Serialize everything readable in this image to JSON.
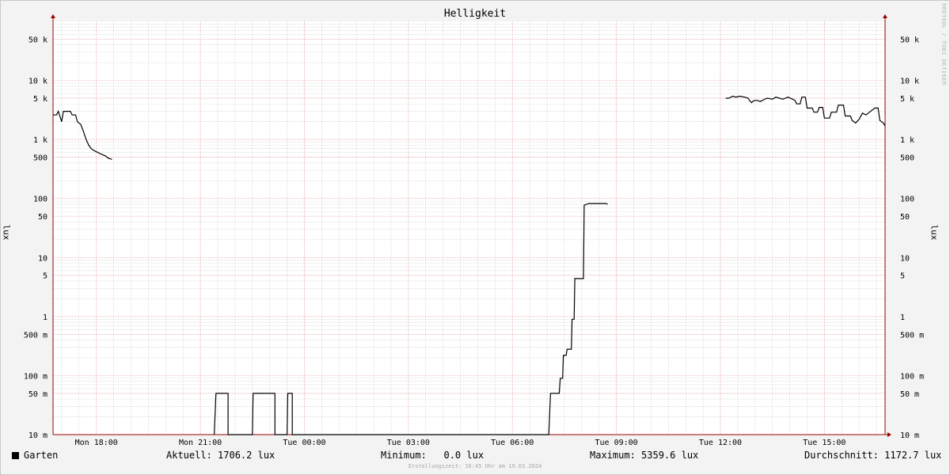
{
  "chart_data": {
    "type": "line",
    "title": "Helligkeit",
    "ylabel": "lux",
    "yscale": "log",
    "ylim": [
      0.01,
      100000
    ],
    "y_ticks": [
      {
        "value": 50000,
        "label": "50 k"
      },
      {
        "value": 10000,
        "label": "10 k"
      },
      {
        "value": 5000,
        "label": "5 k"
      },
      {
        "value": 1000,
        "label": "1 k"
      },
      {
        "value": 500,
        "label": "500"
      },
      {
        "value": 100,
        "label": "100"
      },
      {
        "value": 50,
        "label": "50"
      },
      {
        "value": 10,
        "label": "10"
      },
      {
        "value": 5,
        "label": "5"
      },
      {
        "value": 1,
        "label": "1"
      },
      {
        "value": 0.5,
        "label": "500 m"
      },
      {
        "value": 0.1,
        "label": "100 m"
      },
      {
        "value": 0.05,
        "label": "50 m"
      },
      {
        "value": 0.01,
        "label": "10 m"
      }
    ],
    "x_ticks": [
      "Mon 18:00",
      "Mon 21:00",
      "Tue 00:00",
      "Tue 03:00",
      "Tue 06:00",
      "Tue 09:00",
      "Tue 12:00",
      "Tue 15:00"
    ],
    "x_unit": "hours relative to Mon 18:00",
    "xlim": [
      -1.25,
      22.75
    ],
    "grid": true,
    "series": [
      {
        "name": "Garten",
        "color": "#000000",
        "segments": [
          [
            [
              -1.25,
              2600
            ],
            [
              -1.15,
              2600
            ],
            [
              -1.1,
              3000
            ],
            [
              -1.0,
              2000
            ],
            [
              -0.95,
              3000
            ],
            [
              -0.75,
              3000
            ],
            [
              -0.7,
              2600
            ],
            [
              -0.6,
              2600
            ],
            [
              -0.55,
              2000
            ],
            [
              -0.45,
              1800
            ],
            [
              -0.38,
              1400
            ],
            [
              -0.32,
              1100
            ],
            [
              -0.28,
              950
            ],
            [
              -0.22,
              800
            ],
            [
              -0.15,
              700
            ],
            [
              -0.05,
              640
            ],
            [
              0.05,
              600
            ],
            [
              0.15,
              560
            ],
            [
              0.25,
              530
            ],
            [
              0.35,
              480
            ],
            [
              0.4,
              470
            ],
            [
              0.45,
              460
            ]
          ],
          [
            [
              3.4,
              0.01
            ],
            [
              3.45,
              0.05
            ],
            [
              3.8,
              0.05
            ],
            [
              3.8,
              0.01
            ],
            [
              4.5,
              0.01
            ],
            [
              4.52,
              0.05
            ],
            [
              5.15,
              0.05
            ],
            [
              5.15,
              0.01
            ],
            [
              5.5,
              0.01
            ],
            [
              5.52,
              0.05
            ],
            [
              5.65,
              0.05
            ],
            [
              5.65,
              0.01
            ],
            [
              8.8,
              0.01
            ],
            [
              9.0,
              0.01
            ],
            [
              9.0,
              0.01
            ],
            [
              13.05,
              0.01
            ],
            [
              13.1,
              0.05
            ],
            [
              13.35,
              0.05
            ],
            [
              13.38,
              0.09
            ],
            [
              13.45,
              0.09
            ],
            [
              13.47,
              0.22
            ],
            [
              13.55,
              0.22
            ],
            [
              13.58,
              0.28
            ],
            [
              13.7,
              0.28
            ],
            [
              13.72,
              0.9
            ],
            [
              13.78,
              0.9
            ],
            [
              13.8,
              4.4
            ],
            [
              14.05,
              4.4
            ],
            [
              14.07,
              77
            ],
            [
              14.2,
              82
            ],
            [
              14.7,
              82
            ],
            [
              14.75,
              80
            ]
          ],
          [
            [
              18.15,
              5000
            ],
            [
              18.25,
              5000
            ],
            [
              18.35,
              5400
            ],
            [
              18.45,
              5200
            ],
            [
              18.55,
              5400
            ],
            [
              18.7,
              5200
            ],
            [
              18.8,
              5000
            ],
            [
              18.85,
              4500
            ],
            [
              18.9,
              4200
            ],
            [
              18.95,
              4500
            ],
            [
              19.05,
              4600
            ],
            [
              19.15,
              4400
            ],
            [
              19.25,
              4700
            ],
            [
              19.35,
              5000
            ],
            [
              19.5,
              4800
            ],
            [
              19.6,
              5200
            ],
            [
              19.7,
              5000
            ],
            [
              19.8,
              4800
            ],
            [
              19.95,
              5200
            ],
            [
              20.05,
              4900
            ],
            [
              20.15,
              4600
            ],
            [
              20.2,
              4000
            ],
            [
              20.3,
              4000
            ],
            [
              20.35,
              5200
            ],
            [
              20.45,
              5200
            ],
            [
              20.5,
              3400
            ],
            [
              20.65,
              3400
            ],
            [
              20.7,
              2900
            ],
            [
              20.8,
              2900
            ],
            [
              20.85,
              3500
            ],
            [
              20.95,
              3500
            ],
            [
              21.0,
              2300
            ],
            [
              21.15,
              2300
            ],
            [
              21.2,
              2900
            ],
            [
              21.35,
              2900
            ],
            [
              21.4,
              3800
            ],
            [
              21.55,
              3800
            ],
            [
              21.6,
              2500
            ],
            [
              21.75,
              2500
            ],
            [
              21.8,
              2100
            ],
            [
              21.9,
              1900
            ],
            [
              22.0,
              2200
            ],
            [
              22.1,
              2800
            ],
            [
              22.2,
              2600
            ],
            [
              22.3,
              2900
            ],
            [
              22.45,
              3400
            ],
            [
              22.55,
              3400
            ],
            [
              22.6,
              2100
            ],
            [
              22.7,
              1900
            ],
            [
              22.75,
              1700
            ]
          ]
        ]
      }
    ],
    "legend": {
      "series_label": "Garten",
      "aktuell": "Aktuell: 1706.2 lux",
      "minimum": "Minimum:   0.0 lux",
      "maximum": "Maximum: 5359.6 lux",
      "durchschnitt": "Durchschnitt: 1172.7 lux"
    },
    "footer": "Erstellungszeit: 16:45 Uhr am 19.03.2024",
    "watermark": "RRDTOOL / TOBI OETIKER",
    "colors": {
      "background": "#f3f3f3",
      "canvas": "#ffffff",
      "major_grid": "#e7a0a0",
      "minor_grid": "#cccccc",
      "axis_arrow": "#990000",
      "line": "#000000"
    }
  }
}
